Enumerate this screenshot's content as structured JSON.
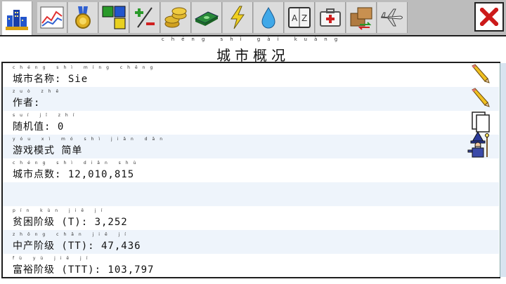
{
  "toolbar": {
    "tabs": [
      {
        "name": "city-overview",
        "icon": "city-icon"
      },
      {
        "name": "graphs",
        "icon": "line-graph-icon"
      },
      {
        "name": "awards",
        "icon": "medal-icon"
      },
      {
        "name": "zones",
        "icon": "color-blocks-icon"
      },
      {
        "name": "budget",
        "icon": "plus-minus-icon"
      },
      {
        "name": "coins",
        "icon": "coins-icon"
      },
      {
        "name": "money",
        "icon": "money-stack-icon"
      },
      {
        "name": "power",
        "icon": "lightning-icon"
      },
      {
        "name": "water",
        "icon": "water-drop-icon"
      },
      {
        "name": "dictionary",
        "icon": "az-book-icon"
      },
      {
        "name": "health",
        "icon": "first-aid-icon"
      },
      {
        "name": "trade",
        "icon": "boxes-icon"
      },
      {
        "name": "airport",
        "icon": "airplane-icon"
      }
    ],
    "close_icon": "close-x-icon",
    "accent_color": "#cc1a1a"
  },
  "title": {
    "pinyin": "chéng shì gài kuàng",
    "text": "城市概况"
  },
  "rows": [
    {
      "pinyin": "chéng shì míng chēng",
      "text": "城市名称: Sie",
      "action_icon": "pencil-edit-icon"
    },
    {
      "pinyin": "zuò zhě",
      "text": "作者:",
      "action_icon": "pencil-edit-icon"
    },
    {
      "pinyin": "suí jī zhí",
      "text": "随机值: 0",
      "action_icon": "copy-page-icon"
    },
    {
      "pinyin": "yóu xì mó shì jiǎn dān",
      "text": "游戏模式 简单",
      "action_icon": "wizard-icon"
    },
    {
      "pinyin": "chéng shì diǎn shù",
      "text": "城市点数: 12,010,815"
    },
    {
      "pinyin": "",
      "text": ""
    },
    {
      "pinyin": "pín kùn jiē jí",
      "text": "贫困阶级 (T): 3,252"
    },
    {
      "pinyin": "zhōng chǎn jiē jí",
      "text": "中产阶级 (TT): 47,436"
    },
    {
      "pinyin": "fù yù jiē jí",
      "text": "富裕阶级 (TTT): 103,797"
    }
  ]
}
